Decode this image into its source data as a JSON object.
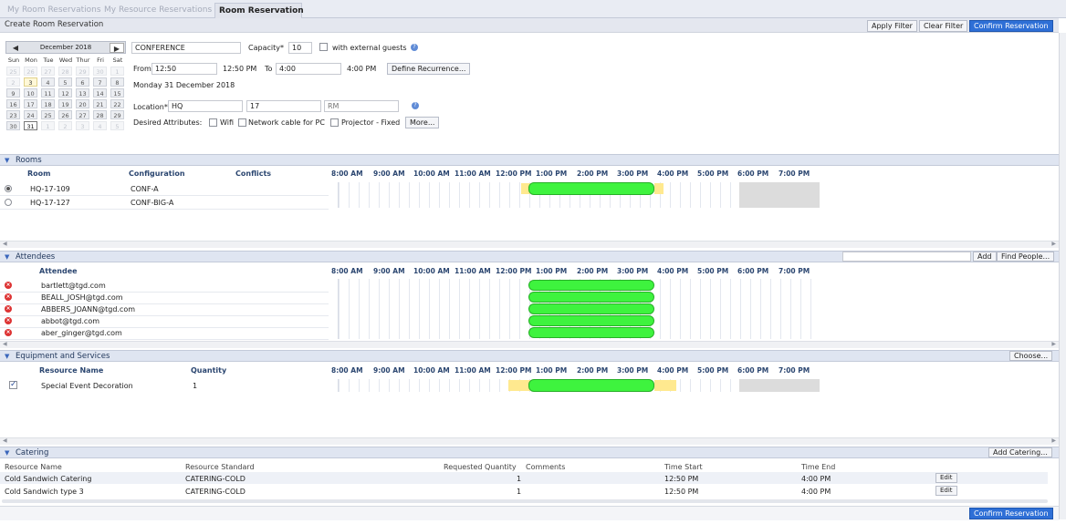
{
  "tabs": [
    {
      "label": "My Room Reservations"
    },
    {
      "label": "My Resource Reservations"
    },
    {
      "label": "Room Reservation"
    }
  ],
  "title": "Create Room Reservation",
  "toolbar": {
    "apply_filter": "Apply Filter",
    "clear_filter": "Clear Filter",
    "confirm": "Confirm Reservation"
  },
  "calendar": {
    "month": "December 2018",
    "dow": [
      "Sun",
      "Mon",
      "Tue",
      "Wed",
      "Thur",
      "Fri",
      "Sat"
    ],
    "weeks": [
      [
        "25",
        "26",
        "27",
        "28",
        "29",
        "30",
        "1"
      ],
      [
        "2",
        "3",
        "4",
        "5",
        "6",
        "7",
        "8"
      ],
      [
        "9",
        "10",
        "11",
        "12",
        "13",
        "14",
        "15"
      ],
      [
        "16",
        "17",
        "18",
        "19",
        "20",
        "21",
        "22"
      ],
      [
        "23",
        "24",
        "25",
        "26",
        "27",
        "28",
        "29"
      ],
      [
        "30",
        "31",
        "1",
        "2",
        "3",
        "4",
        "5"
      ]
    ]
  },
  "form": {
    "name": "CONFERENCE",
    "capacity_label": "Capacity*",
    "capacity": "10",
    "external_guests": "with external guests",
    "from_label": "From",
    "from_value": "12:50",
    "from_display": "12:50 PM",
    "to_label": "To",
    "to_value": "4:00",
    "to_display": "4:00 PM",
    "recurrence_button": "Define Recurrence...",
    "date_text": "Monday 31 December 2018",
    "location_label": "Location*",
    "location_site": "HQ",
    "location_floor": "17",
    "location_room_placeholder": "RM",
    "attributes_label": "Desired Attributes:",
    "attributes": [
      "Wifi",
      "Network cable for PC",
      "Projector - Fixed"
    ],
    "more_button": "More..."
  },
  "hours": [
    "8:00 AM",
    "9:00 AM",
    "10:00 AM",
    "11:00 AM",
    "12:00 PM",
    "1:00 PM",
    "2:00 PM",
    "3:00 PM",
    "4:00 PM",
    "5:00 PM",
    "6:00 PM",
    "7:00 PM"
  ],
  "rooms": {
    "title": "Rooms",
    "columns": {
      "room": "Room",
      "configuration": "Configuration",
      "conflicts": "Conflicts"
    },
    "rows": [
      {
        "room": "HQ-17-109",
        "configuration": "CONF-A",
        "conflicts": ""
      },
      {
        "room": "HQ-17-127",
        "configuration": "CONF-BIG-A",
        "conflicts": ""
      }
    ]
  },
  "attendees": {
    "title": "Attendees",
    "column": "Attendee",
    "add_button": "Add",
    "find_button": "Find People...",
    "rows": [
      {
        "email": "bartlett@tgd.com"
      },
      {
        "email": "BEALL_JOSH@tgd.com"
      },
      {
        "email": "ABBERS_JOANN@tgd.com"
      },
      {
        "email": "abbot@tgd.com"
      },
      {
        "email": "aber_ginger@tgd.com"
      }
    ]
  },
  "equipment": {
    "title": "Equipment and Services",
    "choose_button": "Choose...",
    "columns": {
      "name": "Resource Name",
      "quantity": "Quantity"
    },
    "rows": [
      {
        "name": "Special Event Decoration",
        "quantity": "1"
      }
    ]
  },
  "catering": {
    "title": "Catering",
    "add_button": "Add Catering...",
    "columns": {
      "name": "Resource Name",
      "standard": "Resource Standard",
      "qty": "Requested Quantity",
      "comments": "Comments",
      "start": "Time Start",
      "end": "Time End"
    },
    "rows": [
      {
        "name": "Cold Sandwich Catering",
        "standard": "CATERING-COLD",
        "qty": "1",
        "comments": "",
        "start": "12:50 PM",
        "end": "4:00 PM",
        "edit": "Edit"
      },
      {
        "name": "Cold Sandwich type 3",
        "standard": "CATERING-COLD",
        "qty": "1",
        "comments": "",
        "start": "12:50 PM",
        "end": "4:00 PM",
        "edit": "Edit"
      }
    ]
  },
  "colors": {
    "accent": "#2e6fd6",
    "available": "#3ef33e",
    "conflict": "#ffe98f",
    "unavailable": "#dcdcdc"
  }
}
